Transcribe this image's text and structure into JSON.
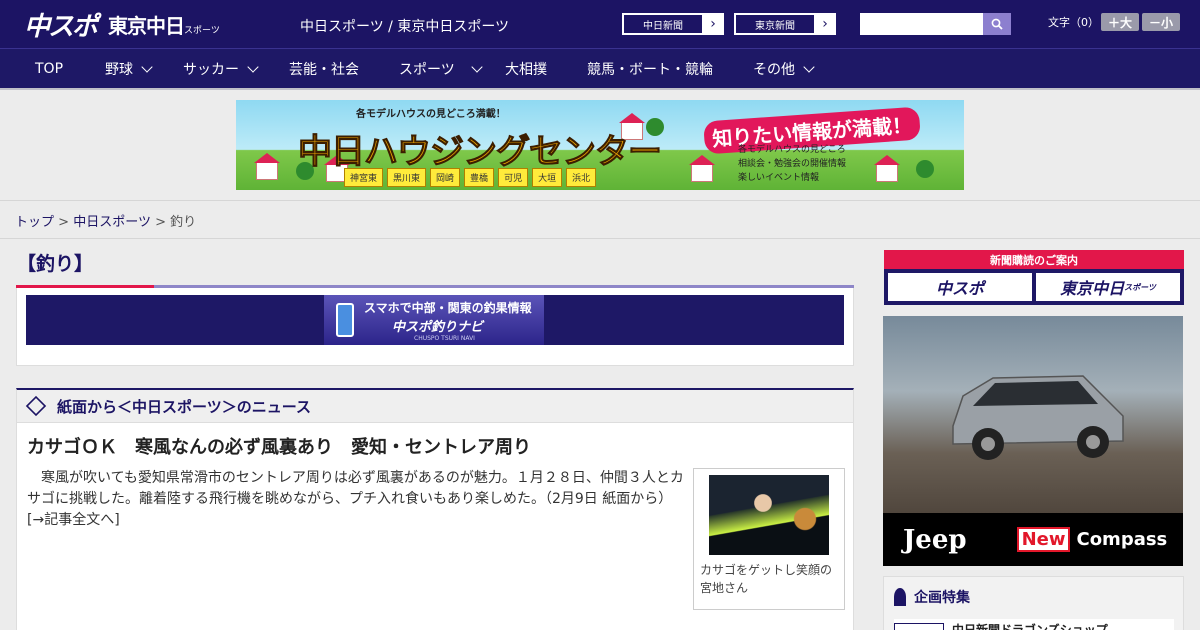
{
  "header": {
    "logo_main": "中スポ",
    "logo_sub": "東京中日",
    "logo_sub_small": "スポーツ",
    "tagline": "中日スポーツ / 東京中日スポーツ",
    "links": [
      {
        "label": "中日新聞",
        "arrow": "›"
      },
      {
        "label": "東京新聞",
        "arrow": "›"
      }
    ],
    "search": {
      "placeholder": "",
      "value": "",
      "icon": "search-icon"
    },
    "font_size_label": "文字（0）",
    "font_larger": "＋大",
    "font_smaller": "－小"
  },
  "nav": [
    {
      "label": "TOP",
      "has_menu": false
    },
    {
      "label": "野球",
      "has_menu": true
    },
    {
      "label": "サッカー",
      "has_menu": true
    },
    {
      "label": "芸能・社会",
      "has_menu": false
    },
    {
      "label": "スポーツ",
      "has_menu": true
    },
    {
      "label": "大相撲",
      "has_menu": false
    },
    {
      "label": "競馬・ボート・競輪",
      "has_menu": false
    },
    {
      "label": "その他",
      "has_menu": true
    }
  ],
  "banner": {
    "subtitle": "各モデルハウスの見どころ満載！",
    "title": "中日ハウジングセンター",
    "badge": "知りたい情報が満載！",
    "features": [
      "各モデルハウスの見どころ",
      "相談会・勉強会の開催情報",
      "楽しいイベント情報"
    ],
    "towns": [
      "神宮東",
      "黒川東",
      "岡崎",
      "豊橋",
      "可児",
      "大垣",
      "浜北"
    ]
  },
  "breadcrumb": {
    "items": [
      "トップ",
      "中日スポーツ",
      "釣り"
    ],
    "separator": ">"
  },
  "page": {
    "title": "【釣り】",
    "promo": {
      "line1": "スマホで中部・関東の釣果情報",
      "line2": "中スポ釣りナビ",
      "line3": "CHUSPO TSURI NAVI"
    },
    "news_section_title": "紙面から＜中日スポーツ＞のニュース",
    "article": {
      "headline": "カサゴＯＫ　寒風なんの必ず風裏あり　愛知・セントレア周り",
      "body": "　寒風が吹いても愛知県常滑市のセントレア周りは必ず風裏があるのが魅力。１月２８日、仲間３人とカサゴに挑戦した。離着陸する飛行機を眺めながら、プチ入れ食いもあり楽しめた。（2月9日 紙面から）",
      "more_link": "[→記事全文へ]",
      "photo_caption": "カサゴをゲットし笑顔の宮地さん"
    }
  },
  "sidebar": {
    "subscribe_label": "新聞購読のご案内",
    "subscribe_buttons": [
      "中スポ",
      "東京中日"
    ],
    "subscribe_button_sub": "スポーツ",
    "ad": {
      "brand": "Jeep",
      "badge": "New",
      "model": "Compass"
    },
    "feature_title": "企画特集",
    "feature_item": "中日新聞ドラゴンズショップ"
  },
  "colors": {
    "brand_navy": "#1c1464",
    "accent_red": "#e2174a",
    "accent_lavender": "#8e86c8"
  }
}
